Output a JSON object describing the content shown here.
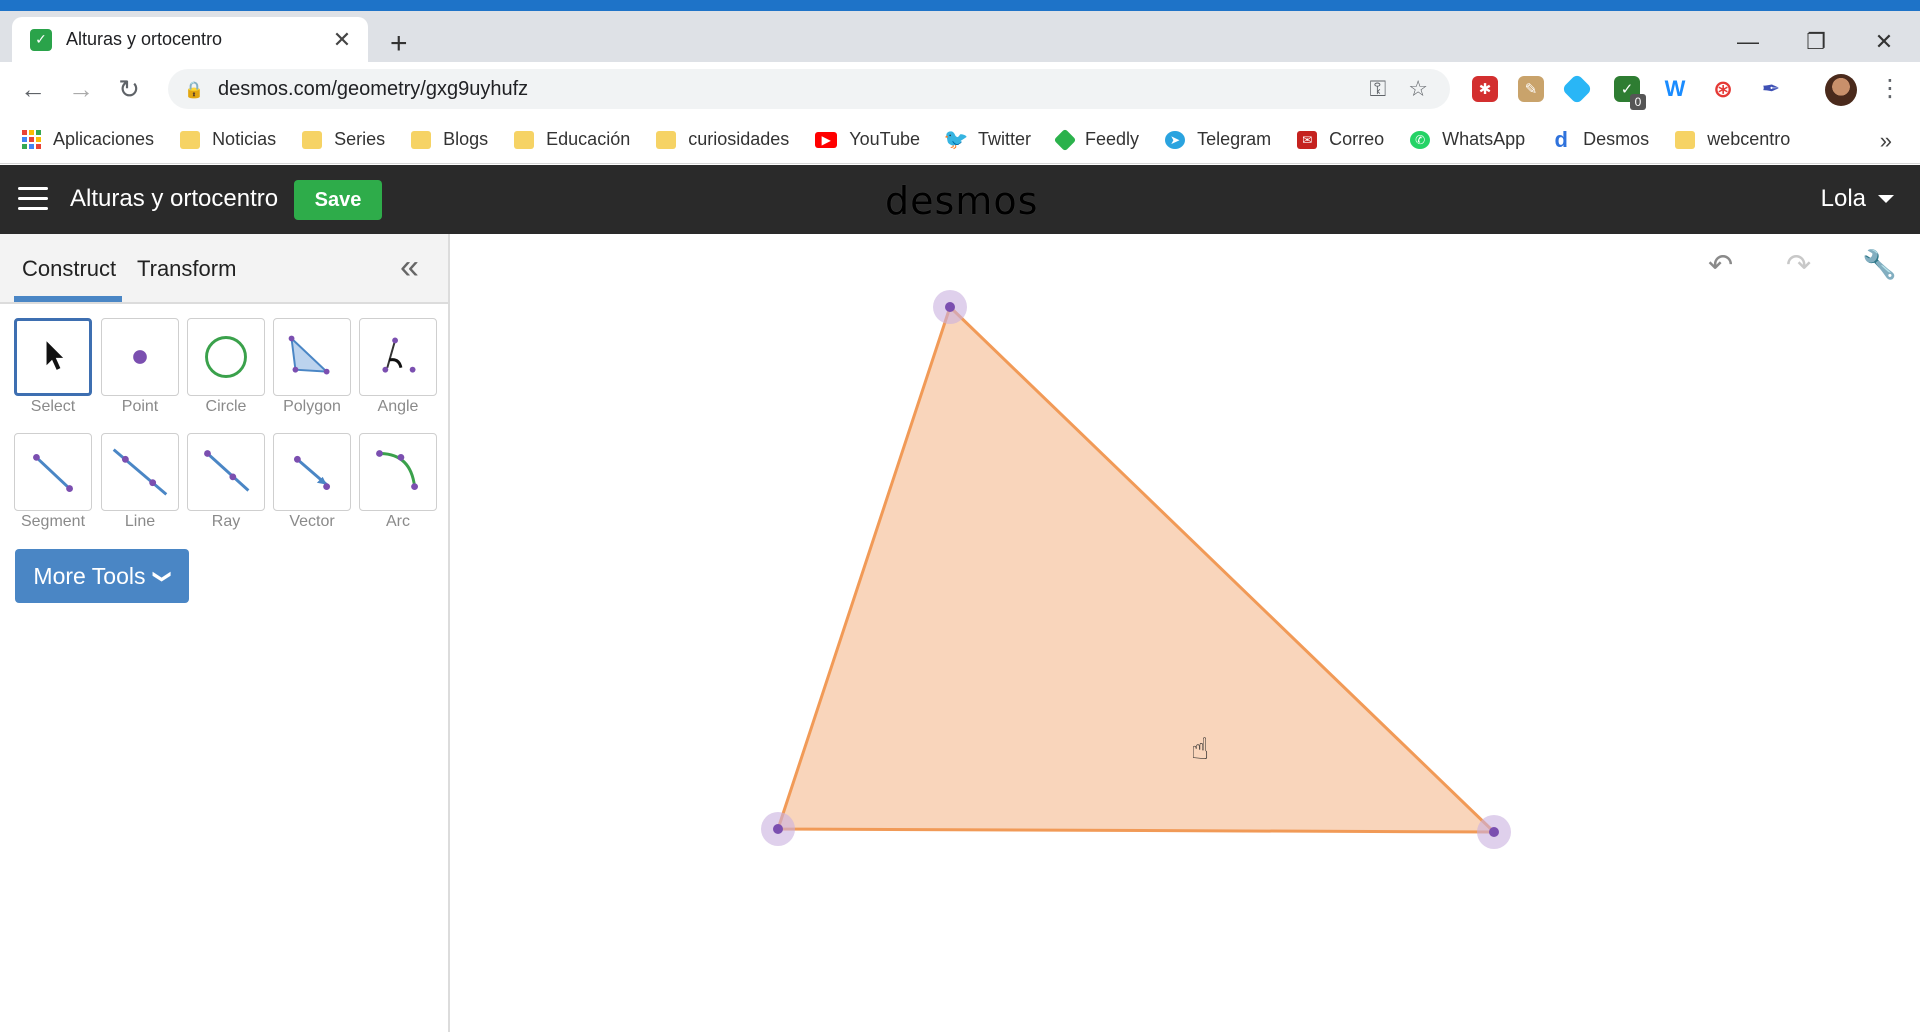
{
  "browser": {
    "tab_title": "Alturas y ortocentro",
    "tab_close": "✕",
    "new_tab": "+",
    "url": "desmos.com/geometry/gxg9uyhufz",
    "window_controls": {
      "minimize": "—",
      "restore": "❐",
      "close": "✕"
    },
    "nav": {
      "back": "←",
      "forward": "→",
      "reload": "↻"
    },
    "extension_badge": "0",
    "bookmarks": [
      {
        "label": "Aplicaciones",
        "icon": "apps-grid-icon",
        "color": "#ea4335"
      },
      {
        "label": "Noticias",
        "icon": "folder-icon",
        "color": "#f6d365"
      },
      {
        "label": "Series",
        "icon": "folder-icon",
        "color": "#f6d365"
      },
      {
        "label": "Blogs",
        "icon": "folder-icon",
        "color": "#f6d365"
      },
      {
        "label": "Educación",
        "icon": "folder-icon",
        "color": "#f6d365"
      },
      {
        "label": "curiosidades",
        "icon": "folder-icon",
        "color": "#f6d365"
      },
      {
        "label": "YouTube",
        "icon": "youtube-icon",
        "color": "#ff0000"
      },
      {
        "label": "Twitter",
        "icon": "twitter-icon",
        "color": "#1da1f2"
      },
      {
        "label": "Feedly",
        "icon": "feedly-icon",
        "color": "#2bb24c"
      },
      {
        "label": "Telegram",
        "icon": "telegram-icon",
        "color": "#2aa3df"
      },
      {
        "label": "Correo",
        "icon": "mail-icon",
        "color": "#c5221f"
      },
      {
        "label": "WhatsApp",
        "icon": "whatsapp-icon",
        "color": "#25d366"
      },
      {
        "label": "Desmos",
        "icon": "desmos-icon",
        "color": "#2f72dc"
      },
      {
        "label": "webcentro",
        "icon": "folder-icon",
        "color": "#f6d365"
      }
    ],
    "bookmarks_more": "»"
  },
  "app": {
    "document_title": "Alturas y ortocentro",
    "save_label": "Save",
    "logo_text": "desmos",
    "user_name": "Lola"
  },
  "panel": {
    "tab_construct": "Construct",
    "tab_transform": "Transform",
    "collapse_glyph": "«",
    "tools_row1": [
      "Select",
      "Point",
      "Circle",
      "Polygon",
      "Angle"
    ],
    "tools_row2": [
      "Segment",
      "Line",
      "Ray",
      "Vector",
      "Arc"
    ],
    "more_tools_label": "More Tools",
    "more_tools_chevron": "❯"
  },
  "canvas": {
    "undo": "↶",
    "redo": "↷",
    "settings": "🔧",
    "polygon_fill": "#f7c7a4",
    "polygon_stroke": "#f19a57",
    "point_color": "#7b4fb0"
  }
}
